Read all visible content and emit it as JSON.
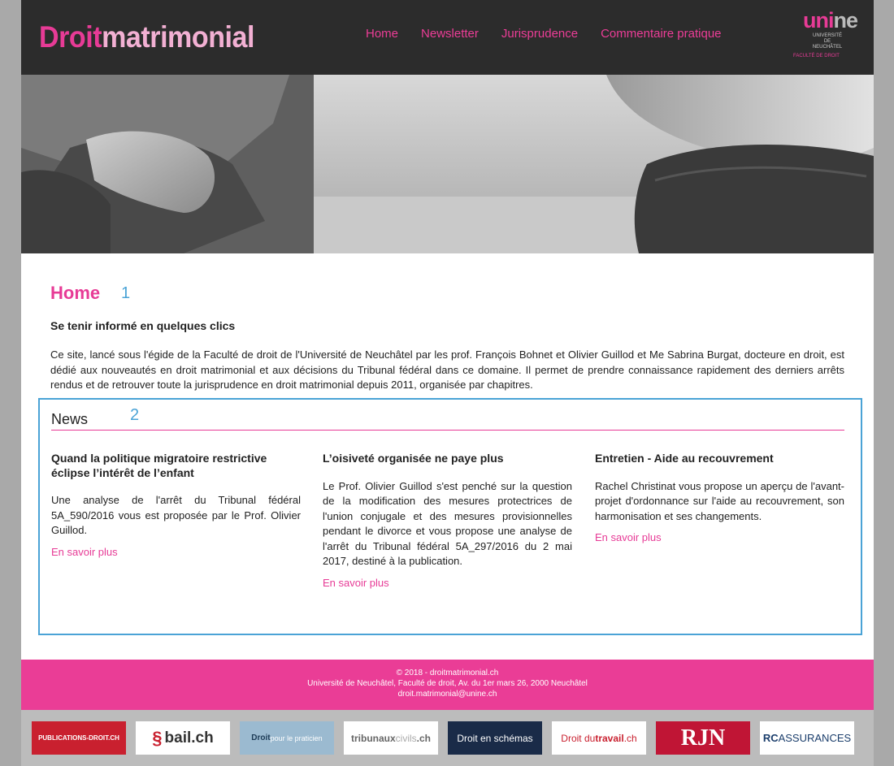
{
  "header": {
    "logo_part1": "Droit",
    "logo_part2": "matrimonial",
    "nav": [
      "Home",
      "Newsletter",
      "Jurisprudence",
      "Commentaire pratique"
    ],
    "university": {
      "word_part1": "uni",
      "word_part2": "ne",
      "line1": "UNIVERSITÉ DE",
      "line2": "NEUCHÂTEL",
      "faculty": "FACULTÉ DE DROIT"
    }
  },
  "main": {
    "title": "Home",
    "marker1": "1",
    "subtitle": "Se tenir informé en quelques clics",
    "intro": "Ce site, lancé sous l'égide de la Faculté de droit de l'Université de Neuchâtel par les prof. François Bohnet et Olivier Guillod et Me Sabrina Burgat, docteure en droit, est dédié aux nouveautés en droit matrimonial et aux décisions du Tribunal fédéral dans ce domaine. Il permet de prendre connaissance rapidement des derniers arrêts rendus et de retrouver toute la jurisprudence en droit matrimonial depuis 2011, organisée par chapitres."
  },
  "news": {
    "title": "News",
    "marker2": "2",
    "items": [
      {
        "title": "Quand la politique migratoire restrictive éclipse l’intérêt de l’enfant",
        "body": "Une analyse de l'arrêt du Tribunal fédéral 5A_590/2016 vous est proposée par le Prof. Olivier Guillod.",
        "link": "En savoir plus"
      },
      {
        "title": "L’oisiveté organisée ne paye plus",
        "body": "Le Prof. Olivier Guillod s'est penché sur la question de la modification des mesures protectrices de l'union conjugale et des mesures provisionnelles pendant le divorce et vous propose une analyse de l'arrêt du Tribunal fédéral 5A_297/2016 du 2 mai 2017, destiné à la publication.",
        "link": "En savoir plus"
      },
      {
        "title": "Entretien - Aide au recouvrement",
        "body": "Rachel Christinat vous propose un aperçu de l'avant-projet d'ordonnance sur l'aide au recouvrement, son harmonisation et ses changements.",
        "link": "En savoir plus"
      }
    ]
  },
  "footer": {
    "line1": "© 2018 - droitmatrimonial.ch",
    "line2": "Université de Neuchâtel, Faculté de droit, Av. du 1er mars 26, 2000 Neuchâtel",
    "line3": "droit.matrimonial@unine.ch"
  },
  "partners": {
    "publications": "PUBLICATIONS-DROIT.CH",
    "bail_symbol": "§",
    "bail": "bail.ch",
    "praticien_a": "Droit",
    "praticien_b": " pour le praticien",
    "tribunaux_a": "tribunaux",
    "tribunaux_b": "civils",
    "tribunaux_c": ".ch",
    "schemas": "Droit en schémas",
    "travail_a": "Droit du ",
    "travail_b": "travail",
    "travail_c": ".ch",
    "rjn": "RJN",
    "rc_a": "RC",
    "rc_b": "ASSURANCES"
  },
  "colors": {
    "brand_pink": "#e73b96",
    "header_bg": "#2c2c2c",
    "annotation_blue": "#4aa3d6",
    "footer_pink": "#ea3d96"
  }
}
